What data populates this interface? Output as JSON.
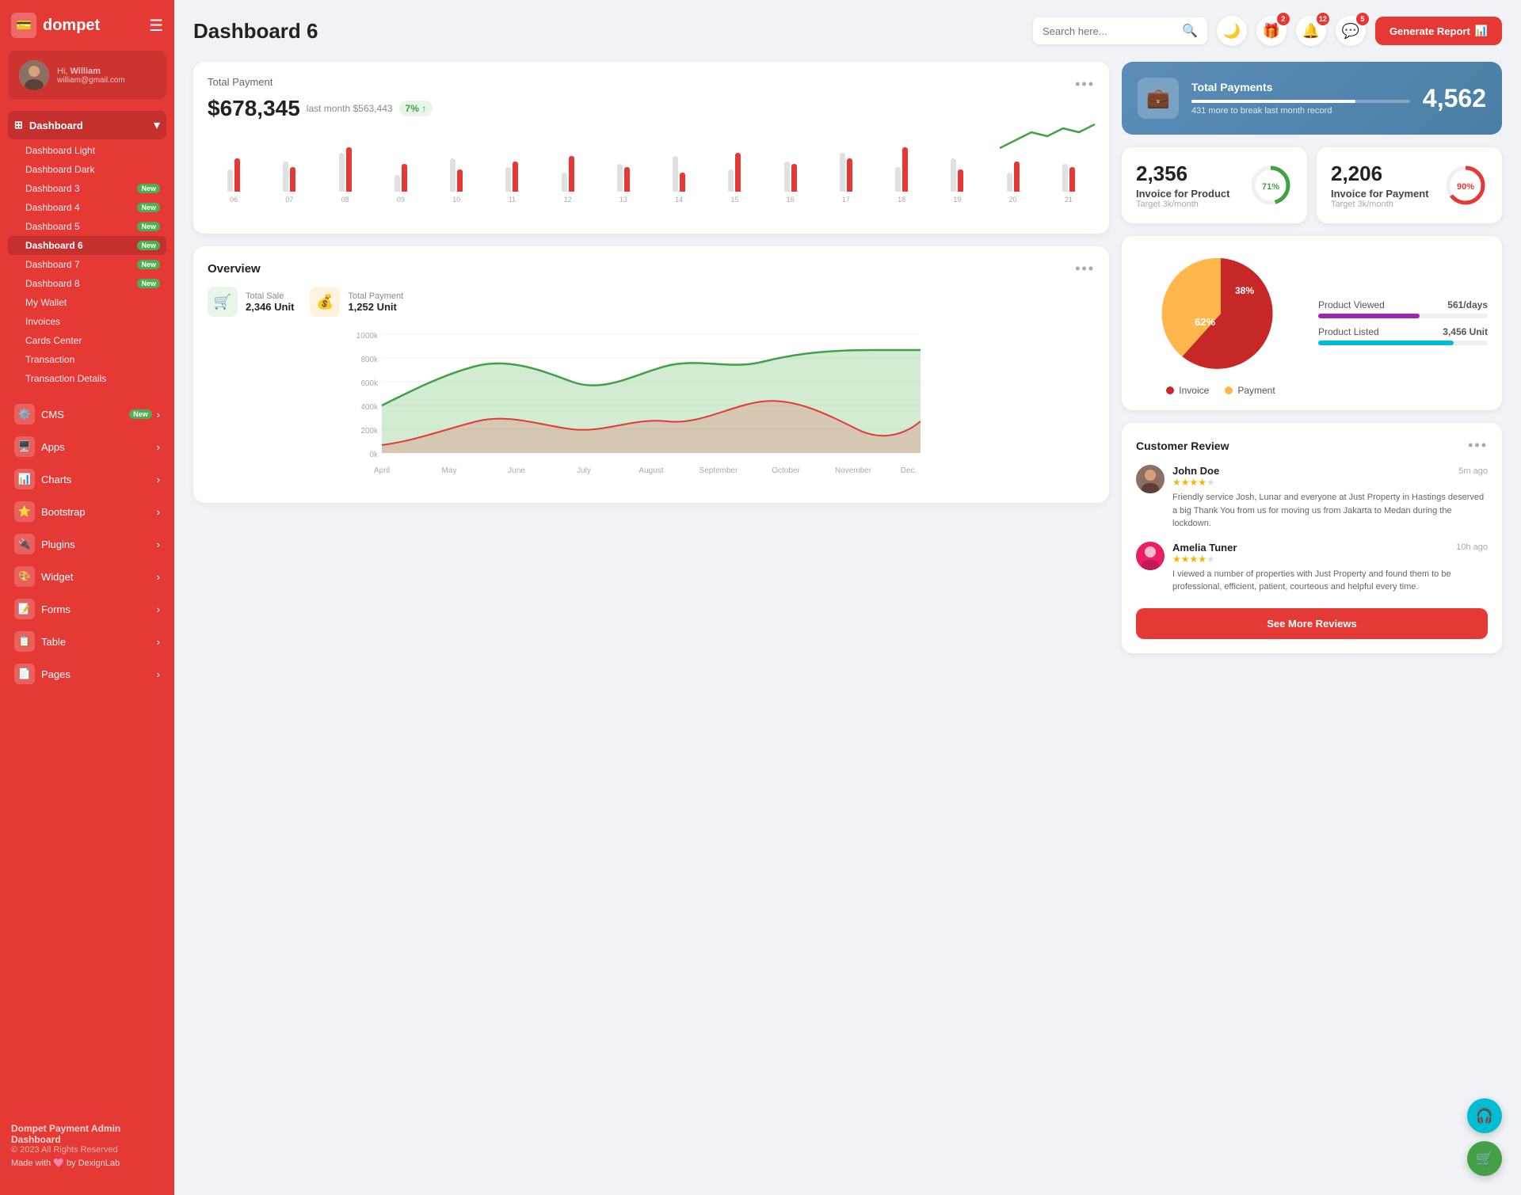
{
  "app": {
    "logo": "💳",
    "name": "dompet",
    "hamburger": "☰"
  },
  "profile": {
    "hi": "Hi,",
    "name": "William",
    "email": "william@gmail.com"
  },
  "sidebar": {
    "dashboard_label": "Dashboard",
    "items": [
      {
        "label": "Dashboard Light",
        "badge": null
      },
      {
        "label": "Dashboard Dark",
        "badge": null
      },
      {
        "label": "Dashboard 3",
        "badge": "New"
      },
      {
        "label": "Dashboard 4",
        "badge": "New"
      },
      {
        "label": "Dashboard 5",
        "badge": "New"
      },
      {
        "label": "Dashboard 6",
        "badge": "New",
        "active": true
      },
      {
        "label": "Dashboard 7",
        "badge": "New"
      },
      {
        "label": "Dashboard 8",
        "badge": "New"
      },
      {
        "label": "My Wallet",
        "badge": null
      },
      {
        "label": "Invoices",
        "badge": null
      },
      {
        "label": "Cards Center",
        "badge": null
      },
      {
        "label": "Transaction",
        "badge": null
      },
      {
        "label": "Transaction Details",
        "badge": null
      }
    ],
    "menu": [
      {
        "icon": "⚙️",
        "label": "CMS",
        "badge": "New",
        "arrow": true
      },
      {
        "icon": "🖥️",
        "label": "Apps",
        "badge": null,
        "arrow": true
      },
      {
        "icon": "📊",
        "label": "Charts",
        "badge": null,
        "arrow": true
      },
      {
        "icon": "⭐",
        "label": "Bootstrap",
        "badge": null,
        "arrow": true
      },
      {
        "icon": "🔌",
        "label": "Plugins",
        "badge": null,
        "arrow": true
      },
      {
        "icon": "🎨",
        "label": "Widget",
        "badge": null,
        "arrow": true
      },
      {
        "icon": "📝",
        "label": "Forms",
        "badge": null,
        "arrow": true
      },
      {
        "icon": "📋",
        "label": "Table",
        "badge": null,
        "arrow": true
      },
      {
        "icon": "📄",
        "label": "Pages",
        "badge": null,
        "arrow": true
      }
    ],
    "footer": {
      "brand": "Dompet Payment Admin Dashboard",
      "copy": "© 2023 All Rights Reserved",
      "made": "Made with 🩷 by DexignLab"
    }
  },
  "header": {
    "title": "Dashboard 6",
    "search_placeholder": "Search here...",
    "icons": [
      {
        "name": "moon-icon",
        "symbol": "🌙",
        "badge": null
      },
      {
        "name": "gift-icon",
        "symbol": "🎁",
        "badge": "2"
      },
      {
        "name": "bell-icon",
        "symbol": "🔔",
        "badge": "12"
      },
      {
        "name": "chat-icon",
        "symbol": "💬",
        "badge": "5"
      }
    ],
    "generate_btn": "Generate Report"
  },
  "total_payment": {
    "label": "Total Payment",
    "amount": "$678,345",
    "last_month_label": "last month $563,443",
    "trend": "7% ↑",
    "dots": "•••",
    "bars": [
      {
        "gray": 40,
        "red": 60,
        "label": "06"
      },
      {
        "gray": 55,
        "red": 45,
        "label": "07"
      },
      {
        "gray": 70,
        "red": 80,
        "label": "08"
      },
      {
        "gray": 30,
        "red": 50,
        "label": "09"
      },
      {
        "gray": 60,
        "red": 40,
        "label": "10"
      },
      {
        "gray": 45,
        "red": 55,
        "label": "11"
      },
      {
        "gray": 35,
        "red": 65,
        "label": "12"
      },
      {
        "gray": 50,
        "red": 45,
        "label": "13"
      },
      {
        "gray": 65,
        "red": 35,
        "label": "14"
      },
      {
        "gray": 40,
        "red": 70,
        "label": "15"
      },
      {
        "gray": 55,
        "red": 50,
        "label": "16"
      },
      {
        "gray": 70,
        "red": 60,
        "label": "17"
      },
      {
        "gray": 45,
        "red": 80,
        "label": "18"
      },
      {
        "gray": 60,
        "red": 40,
        "label": "19"
      },
      {
        "gray": 35,
        "red": 55,
        "label": "20"
      },
      {
        "gray": 50,
        "red": 45,
        "label": "21"
      }
    ]
  },
  "total_payments_blue": {
    "label": "Total Payments",
    "sub": "431 more to break last month record",
    "number": "4,562",
    "fill_pct": 75
  },
  "invoice_product": {
    "number": "2,356",
    "label": "Invoice for Product",
    "target": "Target 3k/month",
    "pct": 71,
    "color": "#43a047"
  },
  "invoice_payment": {
    "number": "2,206",
    "label": "Invoice for Payment",
    "target": "Target 3k/month",
    "pct": 90,
    "color": "#e53935"
  },
  "overview": {
    "title": "Overview",
    "dots": "•••",
    "total_sale_label": "Total Sale",
    "total_sale_value": "2,346 Unit",
    "total_payment_label": "Total Payment",
    "total_payment_value": "1,252 Unit",
    "x_labels": [
      "April",
      "May",
      "June",
      "July",
      "August",
      "September",
      "October",
      "November",
      "Dec."
    ],
    "y_labels": [
      "0k",
      "200k",
      "400k",
      "600k",
      "800k",
      "1000k"
    ]
  },
  "pie_chart": {
    "invoice_pct": 62,
    "payment_pct": 38,
    "invoice_label": "Invoice",
    "payment_label": "Payment",
    "invoice_color": "#c62828",
    "payment_color": "#ffb74d"
  },
  "product_stats": [
    {
      "label": "Product Viewed",
      "value": "561/days",
      "fill_pct": 60,
      "color": "#9c27b0"
    },
    {
      "label": "Product Listed",
      "value": "3,456 Unit",
      "fill_pct": 80,
      "color": "#00bcd4"
    }
  ],
  "customer_review": {
    "title": "Customer Review",
    "dots": "•••",
    "reviews": [
      {
        "name": "John Doe",
        "time": "5m ago",
        "stars": 4,
        "text": "Friendly service Josh, Lunar and everyone at Just Property in Hastings deserved a big Thank You from us for moving us from Jakarta to Medan during the lockdown."
      },
      {
        "name": "Amelia Tuner",
        "time": "10h ago",
        "stars": 4,
        "text": "I viewed a number of properties with Just Property and found them to be professional, efficient, patient, courteous and helpful every time."
      }
    ],
    "see_more_btn": "See More Reviews"
  },
  "float_btns": {
    "support": "🎧",
    "cart": "🛒"
  }
}
